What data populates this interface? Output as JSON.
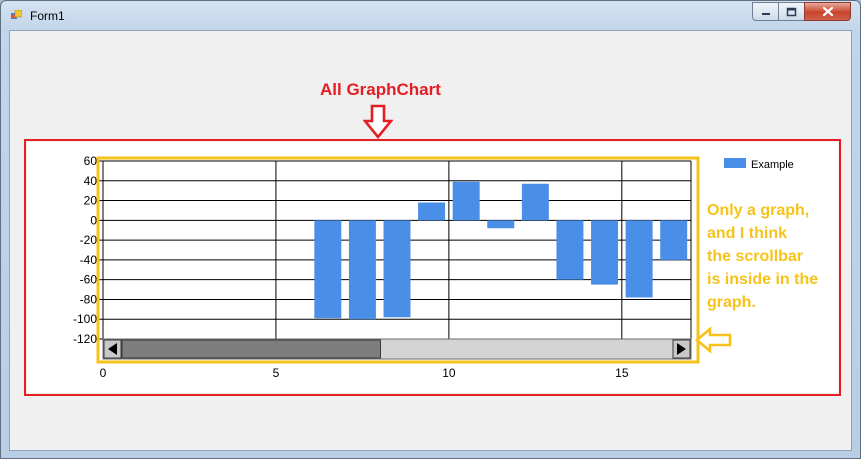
{
  "window": {
    "title": "Form1",
    "minimize_symbol": "–",
    "maximize_symbol": "□",
    "close_symbol": "✕"
  },
  "annotations": {
    "top_label": "All GraphChart",
    "side_label": "Only a graph,\nand I think\nthe scrollbar\nis inside in the\ngraph.",
    "red_color": "#e31e24",
    "yellow_color": "#f7c21a"
  },
  "chart_data": {
    "type": "bar",
    "x": [
      7,
      8,
      9,
      10,
      11,
      12,
      13,
      14,
      15,
      16,
      17
    ],
    "values": [
      -99,
      -100,
      -98,
      18,
      39,
      -8,
      37,
      -60,
      -65,
      -78,
      -40
    ],
    "xlim": [
      0,
      17
    ],
    "ylim": [
      -120,
      60
    ],
    "xticks": [
      0,
      5,
      10,
      15
    ],
    "yticks": [
      60,
      40,
      20,
      0,
      -20,
      -40,
      -60,
      -80,
      -100,
      -120
    ],
    "series": [
      {
        "name": "Example",
        "color": "#4a8fe7"
      }
    ],
    "grid": true,
    "legend_position": "top-right",
    "scrollbar": {
      "position_fraction": 0.0,
      "thumb_fraction": 0.47
    }
  }
}
